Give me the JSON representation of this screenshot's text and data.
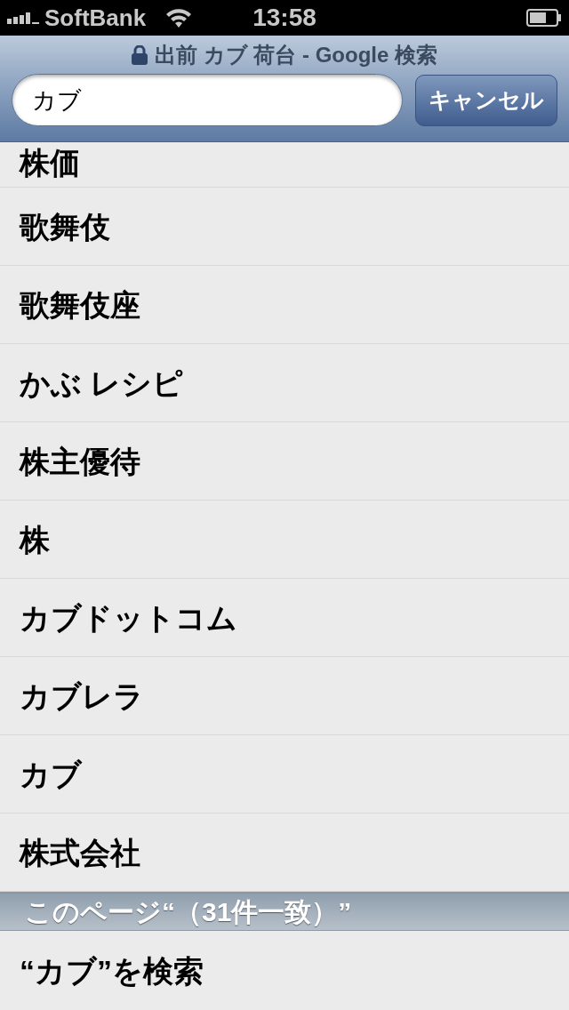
{
  "status_bar": {
    "carrier": "SoftBank",
    "time": "13:58"
  },
  "header": {
    "title": "出前 カブ 荷台 - Google 検索",
    "search": {
      "value": "カブ"
    },
    "cancel_button": "キャンセル"
  },
  "suggestions": [
    {
      "label": "株価"
    },
    {
      "label": "歌舞伎"
    },
    {
      "label": "歌舞伎座"
    },
    {
      "label": "かぶ レシピ"
    },
    {
      "label": "株主優待"
    },
    {
      "label": "株"
    },
    {
      "label": "カブドットコム"
    },
    {
      "label": "カブレラ"
    },
    {
      "label": "カブ"
    },
    {
      "label": "株式会社"
    }
  ],
  "section": {
    "title": "このページ“（31件一致）”"
  },
  "actions": [
    {
      "label": "“カブ”を検索"
    }
  ]
}
